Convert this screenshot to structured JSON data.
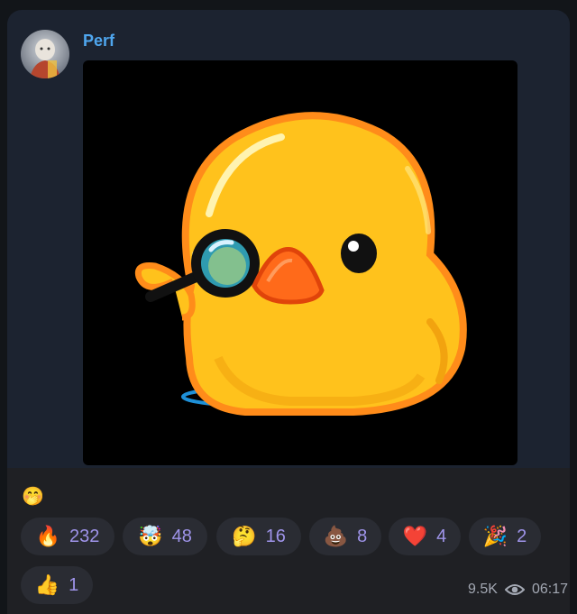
{
  "sender": {
    "name": "Perf"
  },
  "caption": {
    "emoji": "🤭"
  },
  "reactions": [
    {
      "emoji": "🔥",
      "count": "232",
      "icon": "fire-icon"
    },
    {
      "emoji": "🤯",
      "count": "48",
      "icon": "exploding-head-icon"
    },
    {
      "emoji": "🤔",
      "count": "16",
      "icon": "thinking-face-icon"
    },
    {
      "emoji": "💩",
      "count": "8",
      "icon": "poop-icon"
    },
    {
      "emoji": "❤️",
      "count": "4",
      "icon": "heart-icon"
    },
    {
      "emoji": "🎉",
      "count": "2",
      "icon": "party-popper-icon"
    },
    {
      "emoji": "👍",
      "count": "1",
      "icon": "thumbs-up-icon"
    }
  ],
  "meta": {
    "views": "9.5K",
    "time": "06:17"
  },
  "colors": {
    "accent": "#4fa6ee",
    "reaction_text": "#9f94ea",
    "bubble": "#1c2330"
  }
}
